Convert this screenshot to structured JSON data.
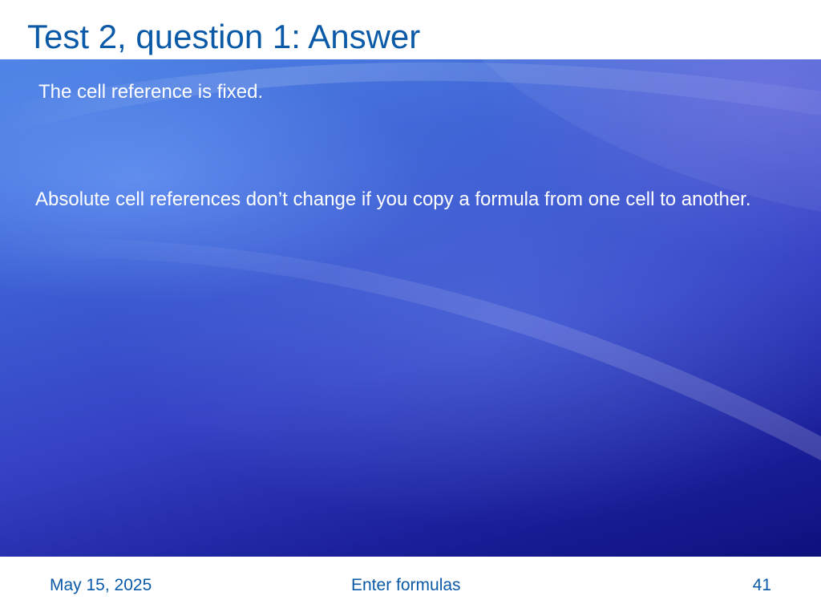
{
  "slide": {
    "title": "Test 2, question 1: Answer",
    "answer": "The cell reference is fixed.",
    "explanation": "Absolute cell references don’t change if you copy a formula from one cell to another."
  },
  "footer": {
    "date": "May 15, 2025",
    "title": "Enter formulas",
    "page_number": "41"
  },
  "colors": {
    "title_text": "#0a5aa8",
    "body_text": "#ffffff",
    "background_top": "#4f86e6",
    "background_bottom": "#0d117d"
  }
}
